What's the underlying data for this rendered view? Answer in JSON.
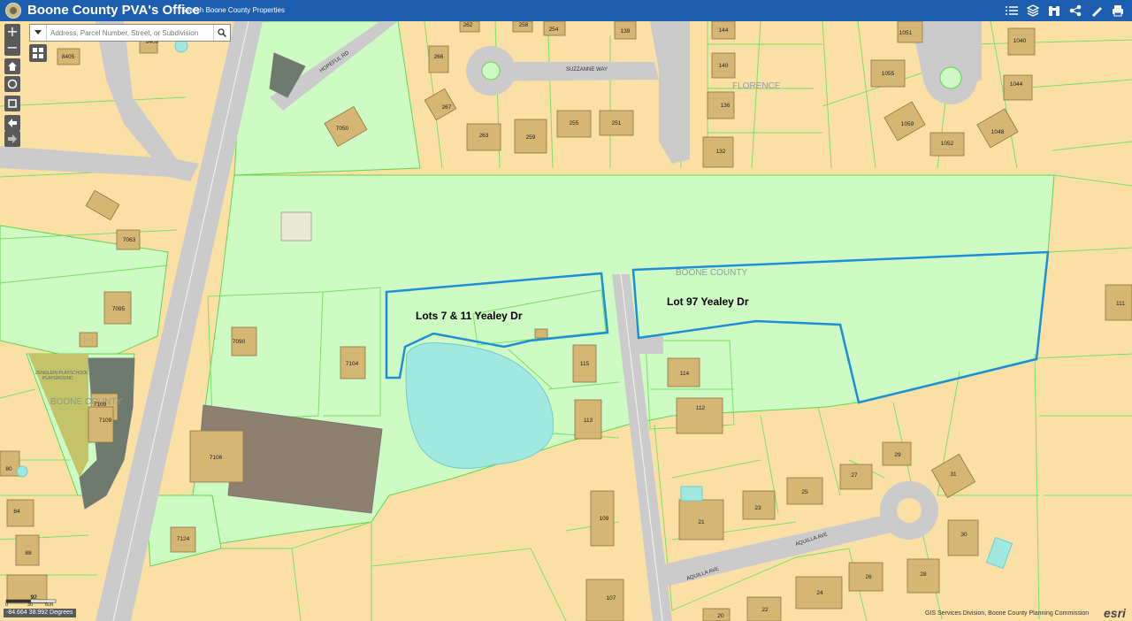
{
  "app": {
    "title": "Boone County PVA's Office",
    "search_link": "Search Boone County Properties"
  },
  "toolbar": {
    "icons": [
      "list-icon",
      "layers-icon",
      "binoculars-icon",
      "share-icon",
      "measure-icon",
      "print-icon"
    ]
  },
  "search": {
    "placeholder": "Address, Parcel Number, Street, or Subdivision"
  },
  "map": {
    "parcel_fill": "#fbe0a6",
    "public_fill": "#cdfbc3",
    "pond_fill": "#a0e8e0",
    "selection_color": "#1d8fd6",
    "annotations": {
      "lot_7_11": "Lots 7 & 11 Yealey Dr",
      "lot_97": "Lot 97 Yealey Dr"
    },
    "places": {
      "florence": "FLORENCE",
      "boone_county_1": "BOONE COUNTY",
      "boone_county_2": "BOONE COUNTY"
    },
    "school": [
      "ZENGLEIN PLAYSCHOOL",
      "PLAYGROUND"
    ],
    "roads": {
      "hopeful": "HOPEFUL RD",
      "suzzanne": "SUZZANNE WAY",
      "aquilla_1": "AQUILLA AVE",
      "aquilla_2": "AQUILLA AVE"
    },
    "address_numbers": [
      "8406",
      "8405",
      "262",
      "258",
      "254",
      "139",
      "144",
      "266",
      "140",
      "1051",
      "1040",
      "1055",
      "1044",
      "267",
      "136",
      "263",
      "259",
      "255",
      "251",
      "1059",
      "1048",
      "1052",
      "132",
      "7050",
      "7063",
      "7095",
      "7090",
      "7104",
      "115",
      "114",
      "112",
      "113",
      "111",
      "7109",
      "7109",
      "7106",
      "80",
      "84",
      "88",
      "92",
      "7124",
      "109",
      "107",
      "21",
      "23",
      "25",
      "27",
      "29",
      "31",
      "30",
      "26",
      "28",
      "24",
      "22",
      "20"
    ]
  },
  "scale": {
    "left": "0",
    "mid": "30",
    "right": "60ft",
    "top": "92"
  },
  "coords": "-84.664 38.992 Degrees",
  "credits": "GIS Services Division, Boone County Planning Commission",
  "esri": "esri"
}
